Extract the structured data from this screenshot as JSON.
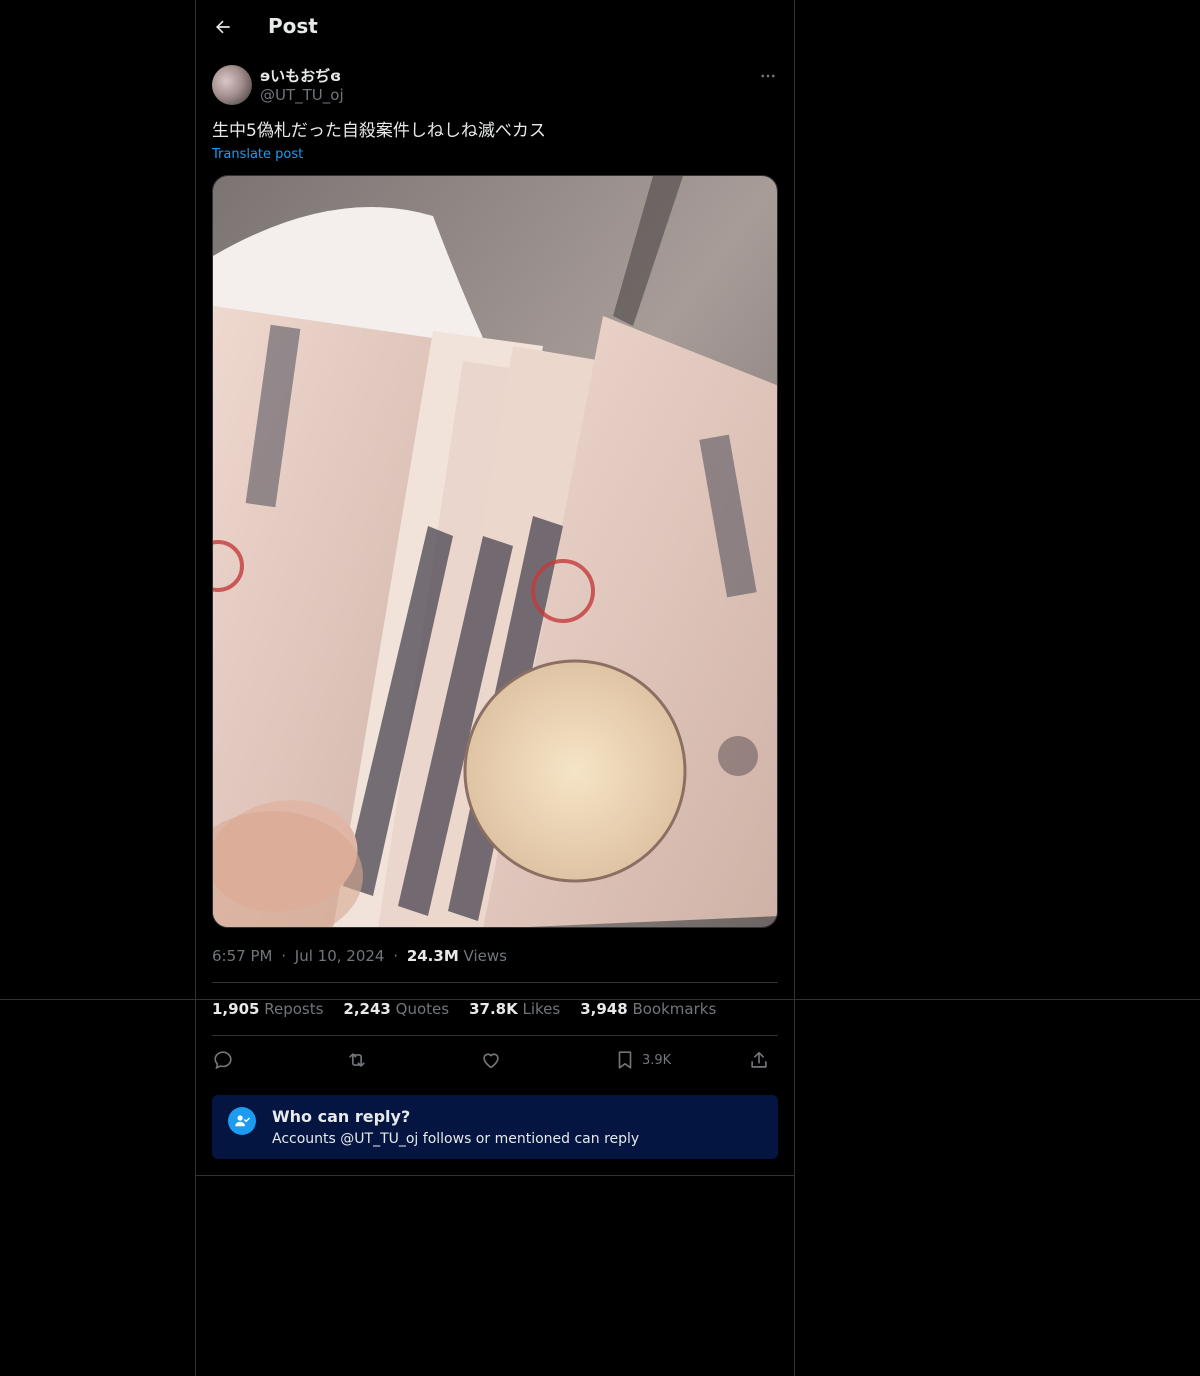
{
  "header": {
    "title": "Post"
  },
  "author": {
    "display_name": "ɘいもおぢɞ",
    "handle": "@UT_TU_oj"
  },
  "post": {
    "text": "生中5偽札だった自殺案件しねしね滅べカス",
    "translate_label": "Translate post",
    "media_description": "photo of several 10000 yen notes",
    "time": "6:57 PM",
    "separator": "·",
    "date": "Jul 10, 2024",
    "views_count": "24.3M",
    "views_label": "Views"
  },
  "stats": {
    "reposts": {
      "count": "1,905",
      "label": "Reposts"
    },
    "quotes": {
      "count": "2,243",
      "label": "Quotes"
    },
    "likes": {
      "count": "37.8K",
      "label": "Likes"
    },
    "bookmarks": {
      "count": "3,948",
      "label": "Bookmarks"
    }
  },
  "actions": {
    "reply_icon": "reply-icon",
    "repost_icon": "repost-icon",
    "like_icon": "like-icon",
    "bookmark_icon": "bookmark-icon",
    "bookmark_count": "3.9K",
    "share_icon": "share-icon"
  },
  "reply_restriction": {
    "title": "Who can reply?",
    "subtitle": "Accounts @UT_TU_oj follows or mentioned can reply",
    "icon": "user-check-icon"
  },
  "colors": {
    "background": "#000000",
    "accent": "#1d9bf0",
    "text_primary": "#e7e9ea",
    "text_secondary": "#71767b",
    "border": "#2f3336",
    "reply_box": "#031540"
  }
}
